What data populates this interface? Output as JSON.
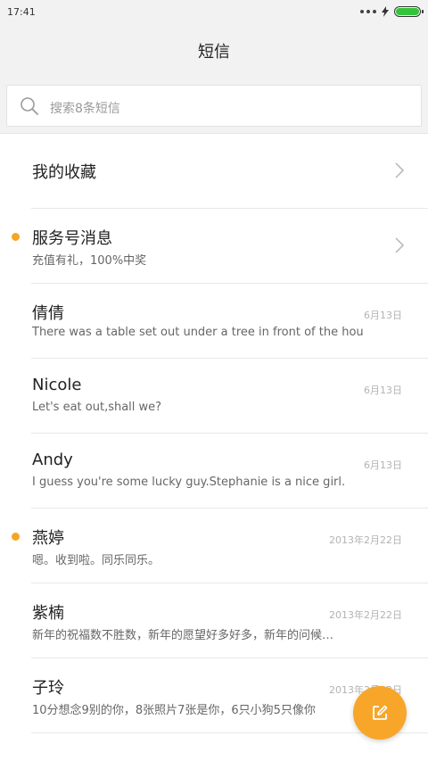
{
  "status_bar": {
    "time": "17:41"
  },
  "header": {
    "title": "短信"
  },
  "search": {
    "placeholder": "搜索8条短信"
  },
  "rows": [
    {
      "name": "我的收藏"
    },
    {
      "name": "服务号消息",
      "preview": "充值有礼，100%中奖"
    },
    {
      "name": "倩倩",
      "preview": "There was a table set out under a tree in front of the hous",
      "date": "6月13日"
    },
    {
      "name": "Nicole",
      "preview": "Let's eat out,shall we?",
      "date": "6月13日"
    },
    {
      "name": "Andy",
      "preview": "I guess you're some lucky guy.Stephanie is a nice girl.",
      "date": "6月13日"
    },
    {
      "name": "燕婷",
      "preview": "嗯。收到啦。同乐同乐。",
      "date": "2013年2月22日"
    },
    {
      "name": "紫楠",
      "preview": "新年的祝福数不胜数，新年的愿望好多好多，新年的问候…",
      "date": "2013年2月22日"
    },
    {
      "name": "子玲",
      "preview": "10分想念9别的你，8张照片7张是你，6只小狗5只像你",
      "date": "2013年2月22日"
    }
  ],
  "colors": {
    "unread_dot": "#f5a623",
    "fab": "#f7a62a",
    "battery": "#33c43a"
  },
  "icons": {
    "search": "search-icon",
    "chevron": "chevron-right-icon",
    "compose": "compose-icon"
  }
}
